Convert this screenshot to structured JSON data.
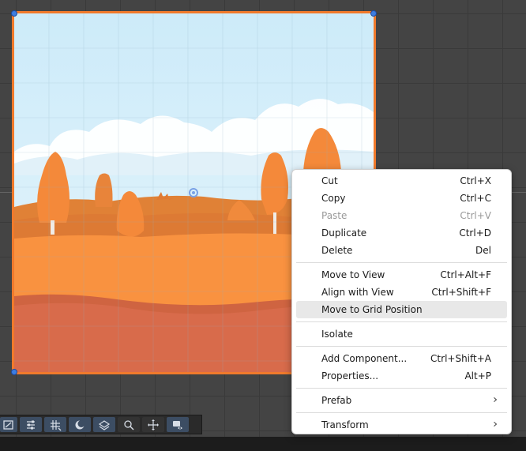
{
  "context_menu": {
    "items": [
      {
        "label": "Cut",
        "shortcut": "Ctrl+X",
        "enabled": true
      },
      {
        "label": "Copy",
        "shortcut": "Ctrl+C",
        "enabled": true
      },
      {
        "label": "Paste",
        "shortcut": "Ctrl+V",
        "enabled": false
      },
      {
        "label": "Duplicate",
        "shortcut": "Ctrl+D",
        "enabled": true
      },
      {
        "label": "Delete",
        "shortcut": "Del",
        "enabled": true
      },
      {
        "label": "Move to View",
        "shortcut": "Ctrl+Alt+F",
        "enabled": true
      },
      {
        "label": "Align with View",
        "shortcut": "Ctrl+Shift+F",
        "enabled": true
      },
      {
        "label": "Move to Grid Position",
        "shortcut": "",
        "enabled": true,
        "highlighted": true
      },
      {
        "label": "Isolate",
        "shortcut": "",
        "enabled": true
      },
      {
        "label": "Add Component...",
        "shortcut": "Ctrl+Shift+A",
        "enabled": true
      },
      {
        "label": "Properties...",
        "shortcut": "Alt+P",
        "enabled": true
      },
      {
        "label": "Prefab",
        "shortcut": "",
        "submenu": true
      },
      {
        "label": "Transform",
        "shortcut": "",
        "submenu": true
      }
    ]
  },
  "toolbar": {
    "buttons": [
      {
        "icon": "transform-gizmo-icon"
      },
      {
        "icon": "sliders-icon"
      },
      {
        "icon": "grid-snap-icon"
      },
      {
        "icon": "lighting-moon-icon"
      },
      {
        "icon": "layers-icon"
      },
      {
        "icon": "search-zoom-icon"
      },
      {
        "icon": "move-arrows-icon"
      },
      {
        "icon": "camera-eye-icon"
      }
    ]
  },
  "colors": {
    "selection_outline": "#f07a2c",
    "handle": "#3d7de0",
    "menu_highlight": "#e8e8e8",
    "sky": "#cdebf9"
  }
}
